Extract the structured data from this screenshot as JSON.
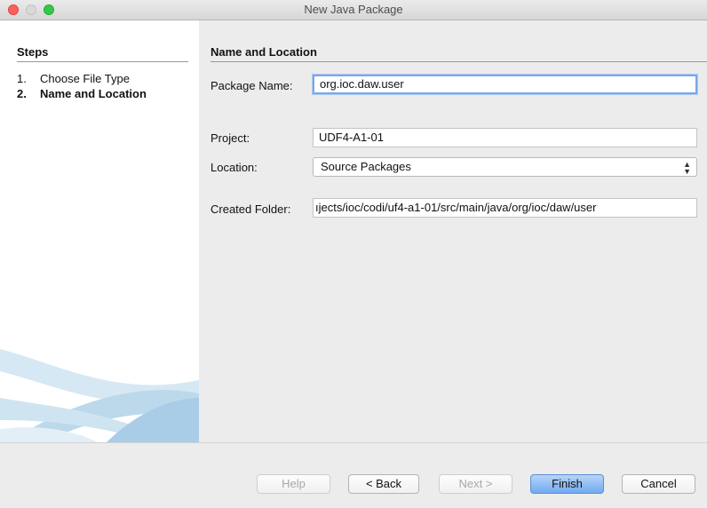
{
  "window": {
    "title": "New Java Package"
  },
  "steps": {
    "heading": "Steps",
    "items": [
      {
        "num": "1.",
        "label": "Choose File Type"
      },
      {
        "num": "2.",
        "label": "Name and Location"
      }
    ]
  },
  "form": {
    "heading": "Name and Location",
    "package_name_label": "Package Name:",
    "package_name_value": "org.ioc.daw.user",
    "project_label": "Project:",
    "project_value": "UDF4-A1-01",
    "location_label": "Location:",
    "location_value": "Source Packages",
    "created_folder_label": "Created Folder:",
    "created_folder_value": "ıjects/ioc/codi/uf4-a1-01/src/main/java/org/ioc/daw/user"
  },
  "buttons": {
    "help": "Help",
    "back": "< Back",
    "next": "Next >",
    "finish": "Finish",
    "cancel": "Cancel"
  }
}
